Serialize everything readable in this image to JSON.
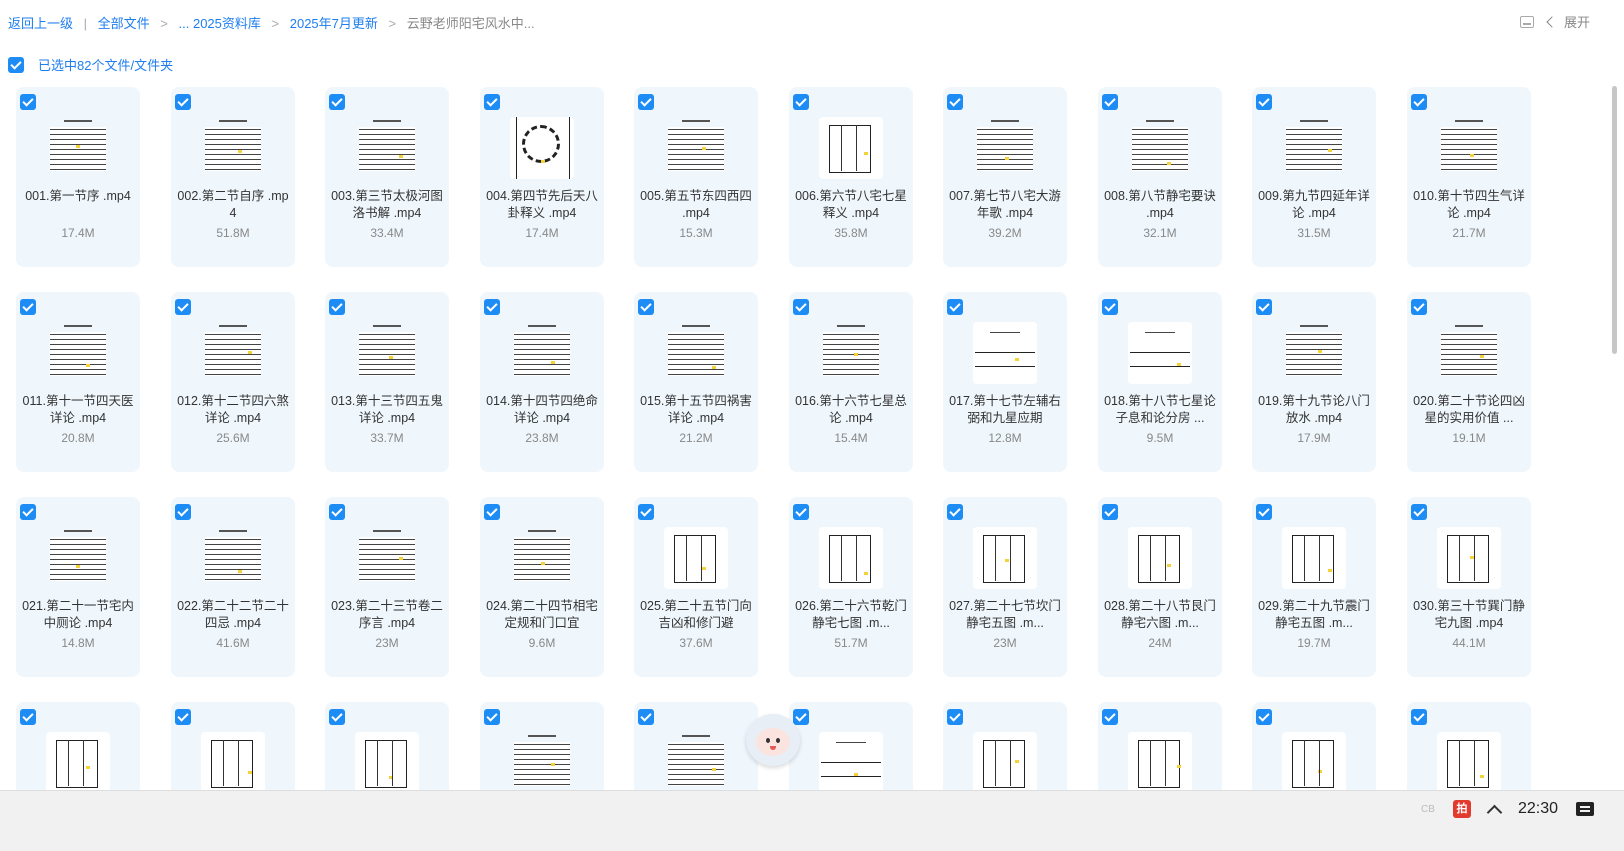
{
  "breadcrumb": {
    "back": "返回上一级",
    "root": "全部文件",
    "crumb1": "... 2025资料库",
    "crumb2": "2025年7月更新",
    "current": "云野老师阳宅风水中..."
  },
  "toolbar": {
    "expand_label": "展开"
  },
  "selection": {
    "label": "已选中82个文件/文件夹",
    "all_checked": true
  },
  "files": [
    {
      "name": "001.第一节序 .mp4",
      "size": "17.4M",
      "thumb": "text"
    },
    {
      "name": "002.第二节自序 .mp4",
      "size": "51.8M",
      "thumb": "text"
    },
    {
      "name": "003.第三节太极河图洛书解 .mp4",
      "size": "33.4M",
      "thumb": "text"
    },
    {
      "name": "004.第四节先后天八卦释义 .mp4",
      "size": "17.4M",
      "thumb": "bagua"
    },
    {
      "name": "005.第五节东四西四 .mp4",
      "size": "15.3M",
      "thumb": "text"
    },
    {
      "name": "006.第六节八宅七星释义 .mp4",
      "size": "35.8M",
      "thumb": "plan"
    },
    {
      "name": "007.第七节八宅大游年歌 .mp4",
      "size": "39.2M",
      "thumb": "text"
    },
    {
      "name": "008.第八节静宅要诀 .mp4",
      "size": "32.1M",
      "thumb": "text"
    },
    {
      "name": "009.第九节四延年详论 .mp4",
      "size": "31.5M",
      "thumb": "text"
    },
    {
      "name": "010.第十节四生气详论 .mp4",
      "size": "21.7M",
      "thumb": "text"
    },
    {
      "name": "011.第十一节四天医详论 .mp4",
      "size": "20.8M",
      "thumb": "text"
    },
    {
      "name": "012.第十二节四六煞详论 .mp4",
      "size": "25.6M",
      "thumb": "text"
    },
    {
      "name": "013.第十三节四五鬼详论 .mp4",
      "size": "33.7M",
      "thumb": "text"
    },
    {
      "name": "014.第十四节四绝命详论 .mp4",
      "size": "23.8M",
      "thumb": "text"
    },
    {
      "name": "015.第十五节四祸害详论 .mp4",
      "size": "21.2M",
      "thumb": "text"
    },
    {
      "name": "016.第十六节七星总论 .mp4",
      "size": "15.4M",
      "thumb": "text"
    },
    {
      "name": "017.第十七节左辅右弼和九星应期",
      "size": "12.8M",
      "thumb": "lines"
    },
    {
      "name": "018.第十八节七星论子息和论分房 ...",
      "size": "9.5M",
      "thumb": "lines"
    },
    {
      "name": "019.第十九节论八门放水 .mp4",
      "size": "17.9M",
      "thumb": "text"
    },
    {
      "name": "020.第二十节论四凶星的实用价值 ...",
      "size": "19.1M",
      "thumb": "text"
    },
    {
      "name": "021.第二十一节宅内中厕论 .mp4",
      "size": "14.8M",
      "thumb": "text"
    },
    {
      "name": "022.第二十二节二十四忌 .mp4",
      "size": "41.6M",
      "thumb": "text"
    },
    {
      "name": "023.第二十三节卷二序言 .mp4",
      "size": "23M",
      "thumb": "text"
    },
    {
      "name": "024.第二十四节相宅定规和门口宜",
      "size": "9.6M",
      "thumb": "text"
    },
    {
      "name": "025.第二十五节门向吉凶和修门避",
      "size": "37.6M",
      "thumb": "plan"
    },
    {
      "name": "026.第二十六节乾门静宅七图 .m...",
      "size": "51.7M",
      "thumb": "plan"
    },
    {
      "name": "027.第二十七节坎门静宅五图 .m...",
      "size": "23M",
      "thumb": "plan"
    },
    {
      "name": "028.第二十八节艮门静宅六图 .m...",
      "size": "24M",
      "thumb": "plan"
    },
    {
      "name": "029.第二十九节震门静宅五图 .m...",
      "size": "19.7M",
      "thumb": "plan"
    },
    {
      "name": "030.第三十节巽门静宅九图 .mp4",
      "size": "44.1M",
      "thumb": "plan"
    },
    {
      "name": "",
      "size": "",
      "thumb": "plan"
    },
    {
      "name": "",
      "size": "",
      "thumb": "plan"
    },
    {
      "name": "",
      "size": "",
      "thumb": "plan"
    },
    {
      "name": "",
      "size": "",
      "thumb": "text"
    },
    {
      "name": "",
      "size": "",
      "thumb": "text"
    },
    {
      "name": "",
      "size": "",
      "thumb": "lines"
    },
    {
      "name": "",
      "size": "",
      "thumb": "plan"
    },
    {
      "name": "",
      "size": "",
      "thumb": "plan"
    },
    {
      "name": "",
      "size": "",
      "thumb": "plan"
    },
    {
      "name": "",
      "size": "",
      "thumb": "plan"
    }
  ],
  "taskbar": {
    "ime": "CB",
    "tray_app": "拍",
    "time": "22:30"
  },
  "colors": {
    "accent": "#1e8cf5",
    "card_bg": "#eff7fd"
  }
}
